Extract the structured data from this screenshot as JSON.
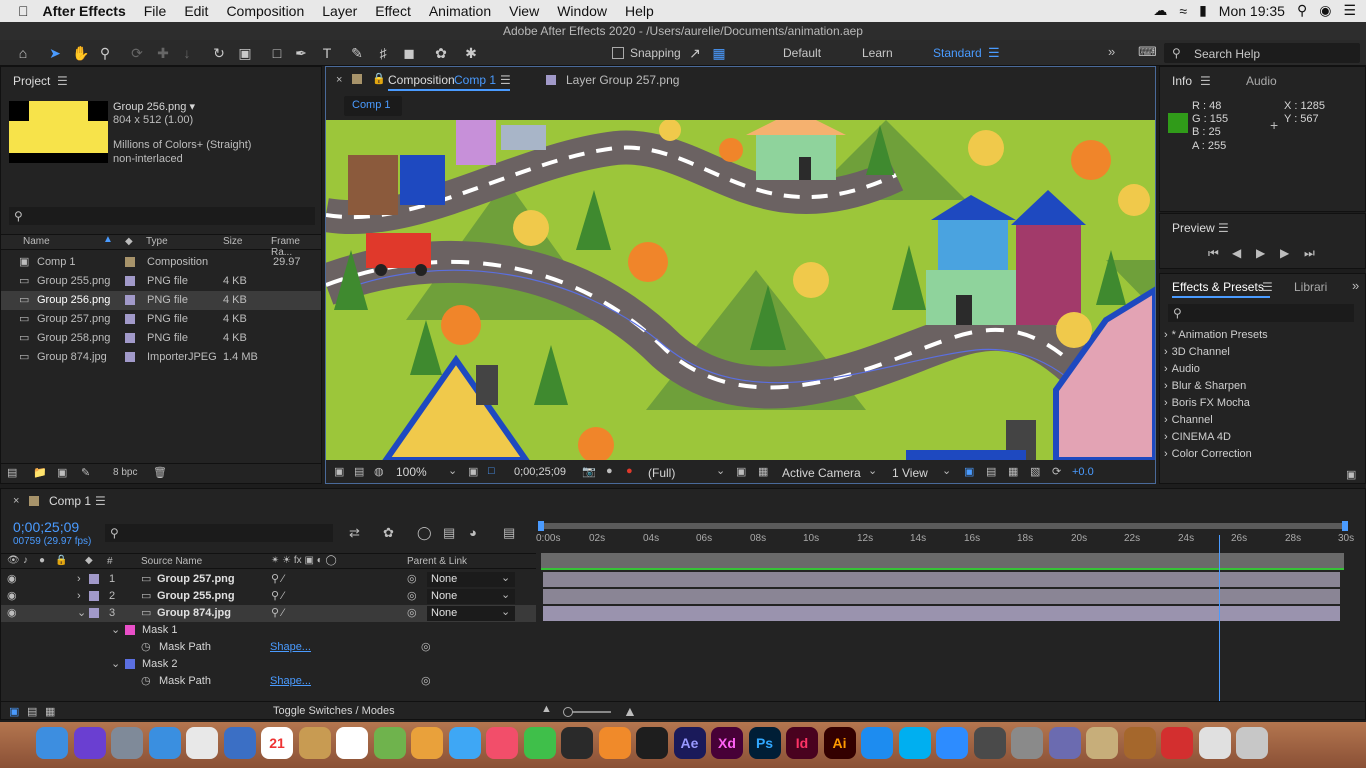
{
  "menubar": {
    "app": "After Effects",
    "items": [
      "File",
      "Edit",
      "Composition",
      "Layer",
      "Effect",
      "Animation",
      "View",
      "Window",
      "Help"
    ],
    "clock": "Mon 19:35"
  },
  "window_title": "Adobe After Effects 2020 - /Users/aurelie/Documents/animation.aep",
  "toolbar": {
    "snapping": "Snapping",
    "workspaces": [
      "Default",
      "Learn",
      "Standard"
    ],
    "search": "Search Help"
  },
  "project": {
    "title": "Project",
    "asset_name": "Group 256.png ▾",
    "asset_size": "804 x 512 (1.00)",
    "asset_colors": "Millions of Colors+ (Straight)",
    "asset_interlace": "non-interlaced",
    "columns": [
      "Name",
      "Type",
      "Size",
      "Frame Ra..."
    ],
    "items": [
      {
        "name": "Comp 1",
        "type": "Composition",
        "size": "",
        "fps": "29.97"
      },
      {
        "name": "Group 255.png",
        "type": "PNG file",
        "size": "4 KB",
        "fps": ""
      },
      {
        "name": "Group 256.png",
        "type": "PNG file",
        "size": "4 KB",
        "fps": ""
      },
      {
        "name": "Group 257.png",
        "type": "PNG file",
        "size": "4 KB",
        "fps": ""
      },
      {
        "name": "Group 258.png",
        "type": "PNG file",
        "size": "4 KB",
        "fps": ""
      },
      {
        "name": "Group 874.jpg",
        "type": "ImporterJPEG",
        "size": "1.4 MB",
        "fps": ""
      }
    ],
    "bpc": "8 bpc"
  },
  "comp": {
    "tab_prefix": "Composition",
    "tab_name": "Comp 1",
    "layer_tab": "Layer Group 257.png",
    "breadcrumb": "Comp 1",
    "zoom": "100%",
    "time": "0;00;25;09",
    "resolution": "(Full)",
    "camera": "Active Camera",
    "views": "1 View",
    "exposure": "+0.0"
  },
  "info": {
    "tab": "Info",
    "tab2": "Audio",
    "r": "R : 48",
    "g": "G : 155",
    "b": "B : 25",
    "a": "A : 255",
    "x": "X : 1285",
    "y": "Y : 567",
    "swatch": "#309b19"
  },
  "preview": {
    "title": "Preview"
  },
  "effects": {
    "title": "Effects & Presets",
    "tab2": "Librari",
    "items": [
      "* Animation Presets",
      "3D Channel",
      "Audio",
      "Blur & Sharpen",
      "Boris FX Mocha",
      "Channel",
      "CINEMA 4D",
      "Color Correction"
    ]
  },
  "timeline": {
    "comp": "Comp 1",
    "timecode": "0;00;25;09",
    "frames": "00759 (29.97 fps)",
    "col_source": "Source Name",
    "col_parent": "Parent & Link",
    "ticks": [
      "0:00s",
      "02s",
      "04s",
      "06s",
      "08s",
      "10s",
      "12s",
      "14s",
      "16s",
      "18s",
      "20s",
      "22s",
      "24s",
      "26s",
      "28s",
      "30s"
    ],
    "layers": [
      {
        "num": "1",
        "name": "Group 257.png",
        "parent": "None"
      },
      {
        "num": "2",
        "name": "Group 255.png",
        "parent": "None"
      },
      {
        "num": "3",
        "name": "Group 874.jpg",
        "parent": "None"
      }
    ],
    "masks": [
      {
        "name": "Mask 1",
        "prop": "Mask Path",
        "value": "Shape...",
        "color": "#e94fc8"
      },
      {
        "name": "Mask 2",
        "prop": "Mask Path",
        "value": "Shape...",
        "color": "#5b6fe0"
      }
    ],
    "toggle": "Toggle Switches / Modes",
    "playhead_fraction": 0.844
  },
  "dock": {
    "icons": [
      "finder-icon",
      "siri-icon",
      "launchpad-icon",
      "safari-icon",
      "chrome-icon",
      "preview-icon",
      "calendar-icon",
      "notes-icon",
      "reminders-icon",
      "maps-icon",
      "photos-icon",
      "messages-icon",
      "music-icon",
      "facetime-icon",
      "vector-icon",
      "books-icon",
      "figma-icon",
      "ae-icon",
      "xd-icon",
      "ps-icon",
      "id-icon",
      "ai-icon",
      "appstore-icon",
      "skype-icon",
      "zoom-icon",
      "misc-icon",
      "settings-icon",
      "misc2-icon",
      "misc3-icon",
      "instrument-icon",
      "acrobat-icon",
      "finder2-icon",
      "trash-icon"
    ],
    "labels": {
      "calendar": "21",
      "ae": "Ae",
      "xd": "Xd",
      "ps": "Ps",
      "id": "Id",
      "ai": "Ai"
    }
  }
}
